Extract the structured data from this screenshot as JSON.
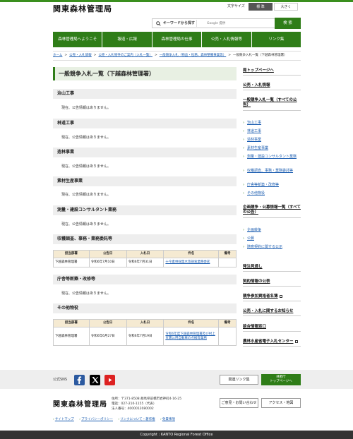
{
  "header": {
    "logo": "関東森林管理局",
    "font_size_label": "文字サイズ",
    "font_size_standard": "標 準",
    "font_size_large": "大きく"
  },
  "search": {
    "label": "キーワードから探す",
    "placeholder": "Google 提供",
    "button": "検 索"
  },
  "global_nav": [
    "森林管理局へようこそ",
    "報道・広報",
    "森林管理局の仕事",
    "公売・入札情報等",
    "リンク集"
  ],
  "breadcrumb": [
    "ホーム",
    "公売・入札情報",
    "公売・入札物件のご案内（入札一覧）",
    "一般競争入札（物品・役務、森林整備事業等）",
    "一般競争入札一覧（下越森林管理署）"
  ],
  "page_title": "一般競争入札一覧（下越森林管理署）",
  "no_info_text": "現在、公告情報はありません。",
  "sections": [
    "治山工事",
    "林道工事",
    "造林事業",
    "素材生産事業",
    "測量・建設コンサルタント業務",
    "収穫調査、事務・業務委託等",
    "庁舎等新築・改修等",
    "その他物役"
  ],
  "table_headers": [
    "担当部署",
    "公告日",
    "入札日",
    "件名",
    "備考"
  ],
  "table_survey": [
    {
      "dept": "下越森林管理署",
      "announce": "令和6年7月10日",
      "bid": "令和6年7月31日",
      "title": "十今素林採集木等調査業務委託",
      "note": ""
    }
  ],
  "table_other": [
    {
      "dept": "下越森林管理署",
      "announce": "令和6年6月27日",
      "bid": "令和6年7月19日",
      "title": "令和6年度下越森林管理署及び村上支署公用自動車の点検等業務",
      "note": ""
    }
  ],
  "sidebar": {
    "top": "局トップページへ",
    "koubai": "公売・入札情報",
    "general": "一般競争入札一覧（すべての公告）",
    "general_items": [
      "治山工事",
      "林道工事",
      "造林事業",
      "素材生産事業",
      "測量・建設コンサルタント業務",
      "収穫調査、事務・業務委託等",
      "庁舎等新築・改修等",
      "その他物役"
    ],
    "planning": "企画競争・公募情報一覧（すべての公告）",
    "planning_items": [
      "企画競争",
      "公募",
      "随意契約に関する公示"
    ],
    "outlook": "発注見通し",
    "contract": "契約情報の公表",
    "qualification": "競争参加資格者名簿",
    "notice": "公売・入札に関するお知らせ",
    "window": "談合情報窓口",
    "eprocure": "農林水産省電子入札センター"
  },
  "footer": {
    "sns_label": "公式SNS",
    "related_button": "関連リンク集",
    "forest_button_1": "林野庁",
    "forest_button_2": "トップページへ",
    "logo": "関東森林管理局",
    "address_1": "住所：〒371-8508 群馬県前橋市岩神町4-16-25",
    "address_2": "電話：027-210-1155（代表）",
    "address_3": "法人番号：4000012080002",
    "contact_button": "ご意見・お問い合わせ",
    "access_button": "アクセス・地図",
    "links": [
      "サイトマップ",
      "プライバシーポリシー",
      "リンクについて・著作権",
      "免責事項"
    ],
    "copyright": "Copyright : KANTO Regional Forest Office"
  },
  "colors": {
    "brand_green": "#2f7d18",
    "link_blue": "#1a5cb0",
    "table_header": "#f5ead2"
  }
}
